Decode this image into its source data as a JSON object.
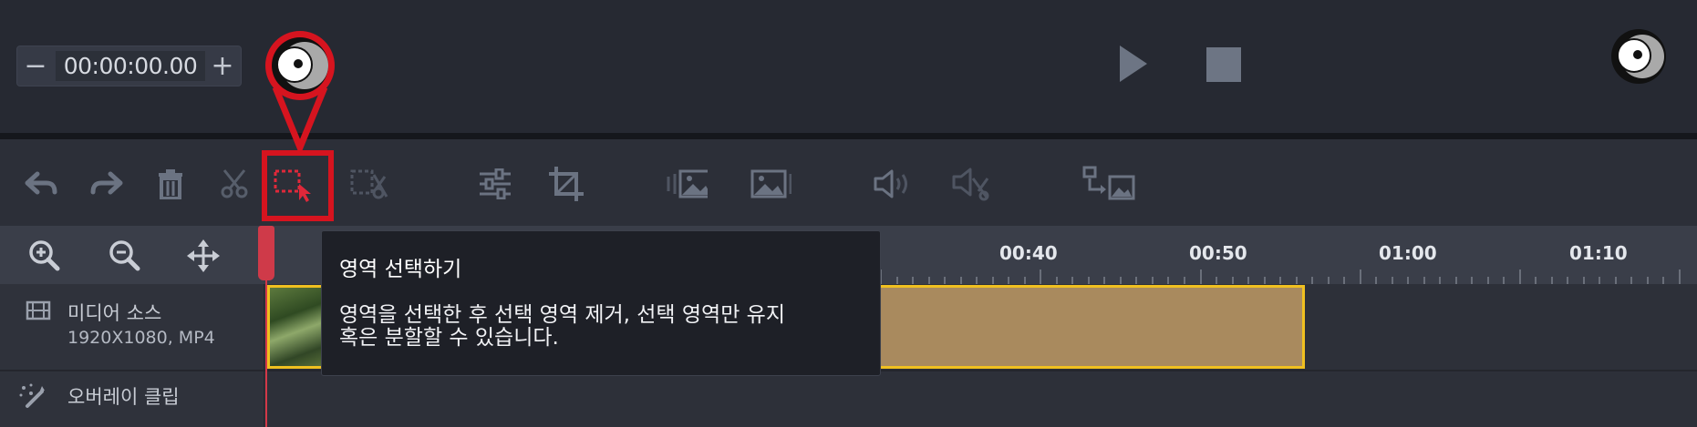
{
  "preview": {
    "timecode": "00:00:00.00",
    "minus_label": "−",
    "plus_label": "+"
  },
  "toolbar": {
    "tools": [
      "undo-icon",
      "redo-icon",
      "trash-icon",
      "scissors-icon",
      "region-select-icon",
      "remove-region-icon",
      "adjust-icon",
      "crop-icon",
      "image-left-icon",
      "image-right-icon",
      "volume-icon",
      "mute-cut-icon",
      "replace-clip-icon"
    ]
  },
  "ruler": {
    "ticks": [
      "00:40",
      "00:50",
      "01:00",
      "01:10"
    ]
  },
  "tracks": {
    "media_source": {
      "title": "미디어 소스",
      "info": "1920X1080, MP4"
    },
    "overlay": {
      "title": "오버레이 클립"
    }
  },
  "tooltip": {
    "title": "영역 선택하기",
    "body_line1": "영역을 선택한 후 선택 영역 제거, 선택 영역만 유지",
    "body_line2": "혹은 분할할 수 있습니다."
  },
  "colors": {
    "accent_red": "#d6141f",
    "clip_fill": "#a98a5e",
    "clip_border": "#f0c020",
    "playhead": "#d33848"
  }
}
